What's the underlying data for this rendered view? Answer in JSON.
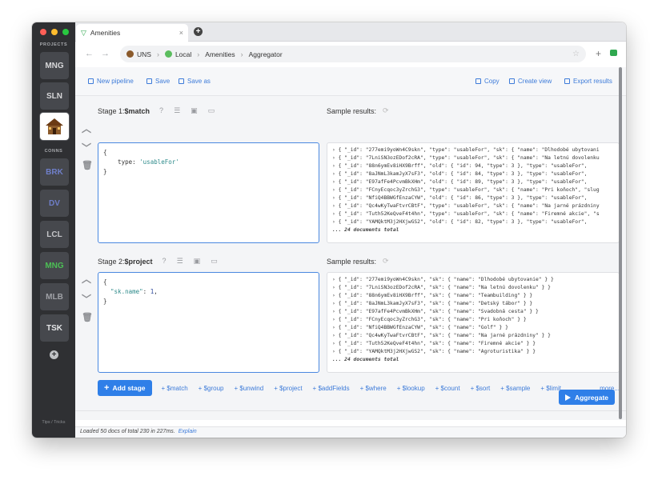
{
  "sidebar": {
    "projects_heading": "PROJECTS",
    "projects": [
      "MNG",
      "SLN"
    ],
    "conns_heading": "CONNS",
    "conns": [
      {
        "label": "BRK",
        "color": "#6f7fc9"
      },
      {
        "label": "DV",
        "color": "#6f7fc9"
      },
      {
        "label": "LCL",
        "color": "#c5c6c9"
      },
      {
        "label": "MNG",
        "color": "#4cbf55"
      },
      {
        "label": "MLB",
        "color": "#9fa1a6"
      },
      {
        "label": "TSK",
        "color": "#e4e5e7"
      }
    ],
    "add_icon": "+",
    "tips": "Tips / Tricks"
  },
  "tab": {
    "title": "Amenities",
    "close": "×",
    "new": "+"
  },
  "address": {
    "crumbs": [
      "UNS",
      "Local",
      "Amenities",
      "Aggregator"
    ],
    "sep": "›",
    "star": "☆",
    "plus": "+"
  },
  "toolbar": {
    "new_pipeline": "New pipeline",
    "save": "Save",
    "save_as": "Save as",
    "copy": "Copy",
    "create_view": "Create view",
    "export_results": "Export results"
  },
  "stages": [
    {
      "label_prefix": "Stage 1: ",
      "label_op": "$match",
      "editor_lines": [
        "{",
        "    type: 'usableFor'",
        "}"
      ],
      "results": [
        "{ \"_id\": \"277emi9yoWn4C9skn\", \"type\": \"usableFor\", \"sk\": { \"name\": \"Dlhodobé ubytovani",
        "{ \"_id\": \"7LniSN3ozEDof2cRA\", \"type\": \"usableFor\", \"sk\": { \"name\": \"Na letnú dovolenku",
        "{ \"_id\": \"88n6ymEv8iHX9Brff\", \"old\": { \"id\": 94, \"type\": 3 }, \"type\": \"usableFor\",",
        "{ \"_id\": \"8aJNmL3kamJyX7sF3\", \"old\": { \"id\": 84, \"type\": 3 }, \"type\": \"usableFor\",",
        "{ \"_id\": \"E97afFe4PcvmBkXHm\", \"old\": { \"id\": 89, \"type\": 3 }, \"type\": \"usableFor\",",
        "{ \"_id\": \"FCnyEcqoc3yZrchG3\", \"type\": \"usableFor\", \"sk\": { \"name\": \"Pri koňoch\", \"slug",
        "{ \"_id\": \"NfiQ4BBWGfEnzaCYW\", \"old\": { \"id\": 86, \"type\": 3 }, \"type\": \"usableFor\",",
        "{ \"_id\": \"Qc4wKyTwaFtvrCBtF\", \"type\": \"usableFor\", \"sk\": { \"name\": \"Na jarné prázdniny",
        "{ \"_id\": \"Tuth52KeQveF4t4hn\", \"type\": \"usableFor\", \"sk\": { \"name\": \"Firemné akcie\", \"s",
        "{ \"_id\": \"YAMQktM3j2HXjwGS2\", \"old\": { \"id\": 82, \"type\": 3 }, \"type\": \"usableFor\","
      ],
      "total": "... 24 documents total"
    },
    {
      "label_prefix": "Stage 2: ",
      "label_op": "$project",
      "editor_lines": [
        "{",
        "  \"sk.name\": 1,",
        "}"
      ],
      "results": [
        "{ \"_id\": \"277emi9yoWn4C9skn\", \"sk\": { \"name\": \"Dlhodobé ubytovanie\" } }",
        "{ \"_id\": \"7LniSN3ozEDof2cRA\", \"sk\": { \"name\": \"Na letnú dovolenku\" } }",
        "{ \"_id\": \"88n6ymEv8iHX9Brff\", \"sk\": { \"name\": \"Teambuilding\" } }",
        "{ \"_id\": \"8aJNmL3kamJyX7sF3\", \"sk\": { \"name\": \"Detský tábor\" } }",
        "{ \"_id\": \"E97afFe4PcvmBkXHm\", \"sk\": { \"name\": \"Svadobná cesta\" } }",
        "{ \"_id\": \"FCnyEcqoc3yZrchG3\", \"sk\": { \"name\": \"Pri koňoch\" } }",
        "{ \"_id\": \"NfiQ4BBWGfEnzaCYW\", \"sk\": { \"name\": \"Golf\" } }",
        "{ \"_id\": \"Qc4wKyTwaFtvrCBtF\", \"sk\": { \"name\": \"Na jarné prázdniny\" } }",
        "{ \"_id\": \"Tuth52KeQveF4t4hn\", \"sk\": { \"name\": \"Firemné akcie\" } }",
        "{ \"_id\": \"YAMQktM3j2HXjwGS2\", \"sk\": { \"name\": \"Agroturistika\" } }"
      ],
      "total": "... 24 documents total"
    }
  ],
  "sample_results_label": "Sample results:",
  "add_stage": "Add stage",
  "quick_stages": [
    "+ $match",
    "+ $group",
    "+ $unwind",
    "+ $project",
    "+ $addFields",
    "+ $where",
    "+ $lookup",
    "+ $count",
    "+ $sort",
    "+ $sample",
    "+ $limit"
  ],
  "more": "more...",
  "aggregate": "Aggregate",
  "status": {
    "text": "Loaded 50 docs of total 230 in 227ms.",
    "explain": "Explain"
  },
  "colors": {
    "accent": "#2f7fe8",
    "link": "#3d7bd9",
    "sidebar": "#2f3033",
    "editor_border": "#4a88e0"
  }
}
